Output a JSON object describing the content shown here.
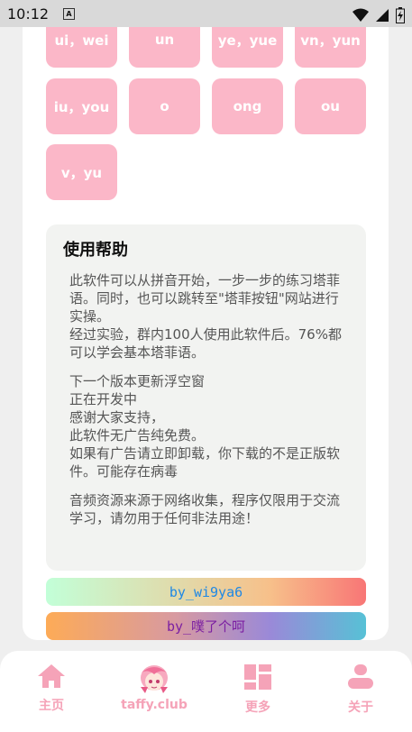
{
  "status_bar": {
    "time": "10:12",
    "notification_letter": "A",
    "icons": [
      "wifi-icon",
      "signal-icon",
      "battery-icon"
    ]
  },
  "pinyin_grid": [
    {
      "label": "ui，wei"
    },
    {
      "label": "un"
    },
    {
      "label": "ye，yue"
    },
    {
      "label": "vn，yun"
    },
    {
      "label": "iu，you"
    },
    {
      "label": "o"
    },
    {
      "label": "ong"
    },
    {
      "label": "ou"
    },
    {
      "label": "v，yu"
    }
  ],
  "help": {
    "title": "使用帮助",
    "paragraphs": [
      "此软件可以从拼音开始，一步一步的练习塔菲语。同时，也可以跳转至\"塔菲按钮\"网站进行实操。\n经过实验，群内100人使用此软件后。76%都可以学会基本塔菲语。",
      "下一个版本更新浮空窗\n正在开发中\n感谢大家支持，\n此软件无广告纯免费。\n如果有广告请立即卸载，你下载的不是正版软件。可能存在病毒",
      "音频资源来源于网络收集，程序仅限用于交流学习，请勿用于任何非法用途！"
    ]
  },
  "credits": {
    "first": "by_wi9ya6",
    "second": "by_噗了个呵"
  },
  "bottom_nav": {
    "items": [
      {
        "label": "主页",
        "icon": "home-icon"
      },
      {
        "label": "taffy.club",
        "icon": "taffy-avatar-icon"
      },
      {
        "label": "更多",
        "icon": "dashboard-icon"
      },
      {
        "label": "关于",
        "icon": "person-icon"
      }
    ]
  },
  "colors": {
    "pill_bg": "#fbb7c8",
    "nav_accent": "#f5a3b8",
    "help_bg": "#f2f3f1"
  }
}
